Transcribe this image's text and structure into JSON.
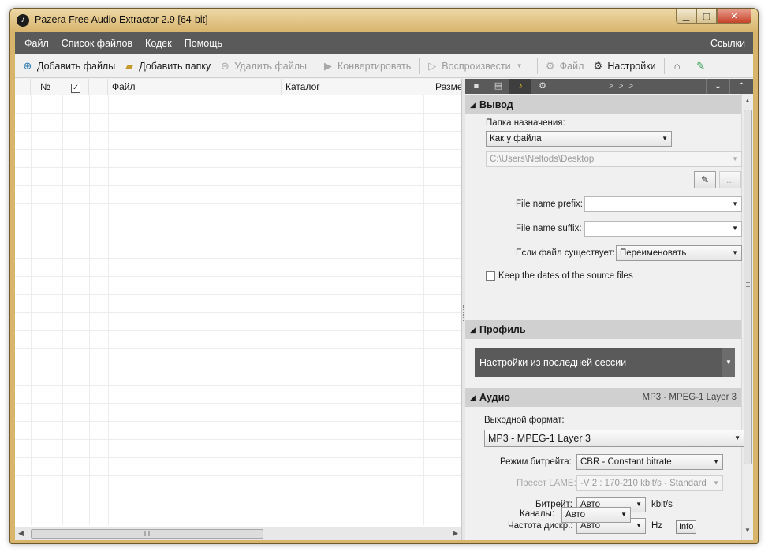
{
  "window": {
    "title": "Pazera Free Audio Extractor 2.9  [64-bit]",
    "minimize_glyph": "▁",
    "maximize_glyph": "▢",
    "close_glyph": "✕"
  },
  "menu": {
    "items": [
      "Файл",
      "Список файлов",
      "Кодек",
      "Помощь"
    ],
    "links": "Ссылки"
  },
  "toolbar": {
    "add_files": "Добавить файлы",
    "add_folder": "Добавить папку",
    "remove_files": "Удалить файлы",
    "convert": "Конвертировать",
    "play": "Воспроизвести",
    "file": "Файл",
    "settings": "Настройки"
  },
  "filelist": {
    "columns": [
      "№",
      "",
      "",
      "Файл",
      "Каталог",
      "Разме"
    ],
    "check_glyph": "✓",
    "scroll_grip": "III"
  },
  "panel": {
    "tabs_more": "> > >",
    "output": {
      "header": "Вывод",
      "dest_folder_label": "Папка назначения:",
      "dest_folder_value": "Как у файла",
      "path_value": "C:\\Users\\Neltods\\Desktop",
      "browse_glyph": "...",
      "prefix_label": "File name prefix:",
      "suffix_label": "File name suffix:",
      "exists_label": "Если  файл  существует:",
      "exists_value": "Переименовать",
      "keep_dates_label": "Keep the dates of the source files"
    },
    "profile": {
      "header": "Профиль",
      "value": "Настройки из последней сессии"
    },
    "audio": {
      "header": "Аудио",
      "header_right": "MP3 - MPEG-1 Layer 3",
      "format_label": "Выходной формат:",
      "format_value": "MP3 - MPEG-1 Layer 3",
      "bitrate_mode_label": "Режим битрейта:",
      "bitrate_mode_value": "CBR - Constant bitrate",
      "lame_preset_label": "Пресет LAME:",
      "lame_preset_value": "-V 2 : 170-210 kbit/s - Standard",
      "bitrate_label": "Битрейт:",
      "bitrate_value": "Авто",
      "bitrate_unit": "kbit/s",
      "samplerate_label": "Частота дискр.:",
      "samplerate_value": "Авто",
      "samplerate_unit": "Hz",
      "info_button": "Info",
      "channels_label": "Каналы:",
      "channels_value": "Авто"
    }
  }
}
